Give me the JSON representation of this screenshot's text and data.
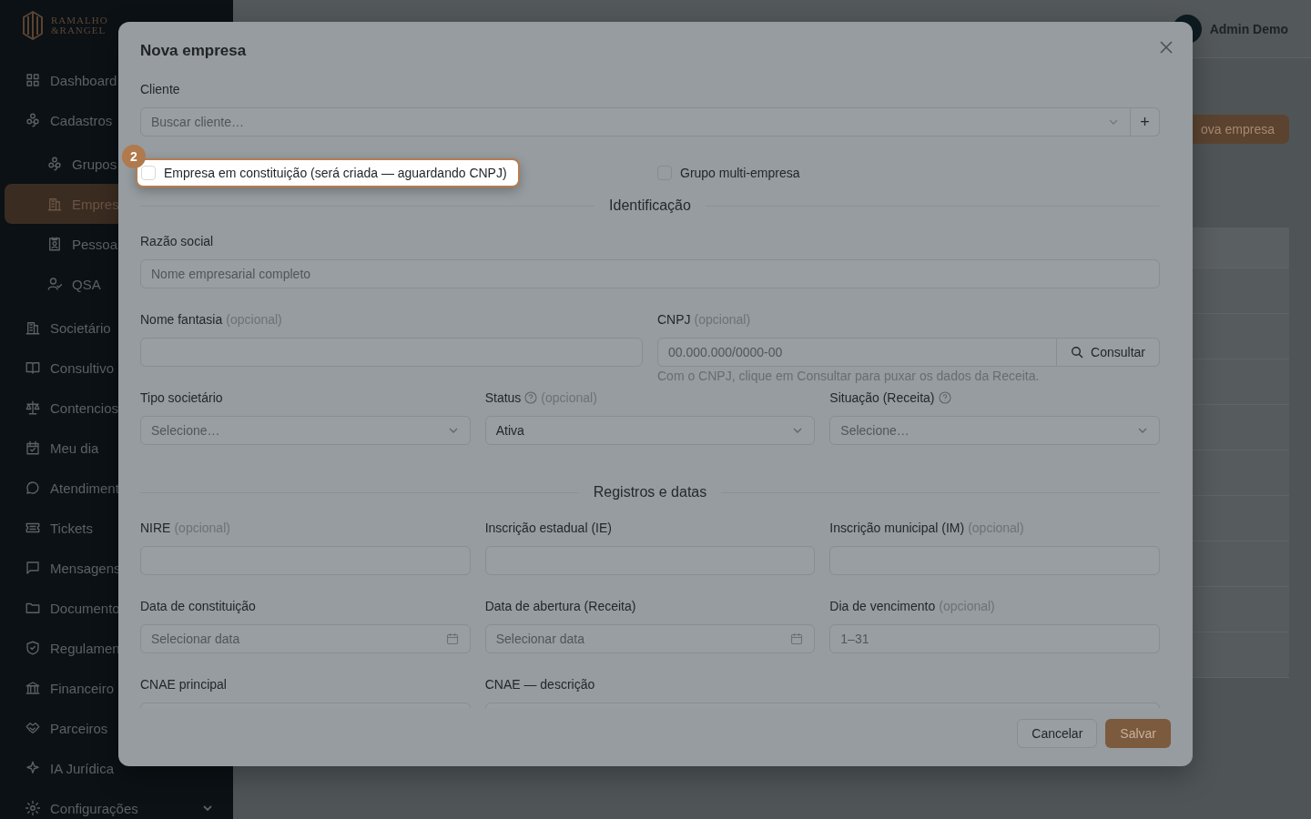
{
  "brand": {
    "line1": "RAMALHO",
    "line2": "&RANGEL"
  },
  "sidebar": {
    "items": [
      {
        "label": "Dashboard",
        "selected": false
      },
      {
        "label": "Cadastros",
        "selected": false,
        "expanded": true,
        "children": [
          {
            "label": "Grupos",
            "selected": false
          },
          {
            "label": "Empres",
            "selected": true
          },
          {
            "label": "Pessoa",
            "selected": false
          },
          {
            "label": "QSA",
            "selected": false
          }
        ]
      },
      {
        "label": "Societário",
        "selected": false
      },
      {
        "label": "Consultivo",
        "selected": false
      },
      {
        "label": "Contencios",
        "selected": false
      },
      {
        "label": "Meu dia",
        "selected": false
      },
      {
        "label": "Atendiment",
        "selected": false
      },
      {
        "label": "Tickets",
        "selected": false
      },
      {
        "label": "Mensagens",
        "selected": false
      },
      {
        "label": "Documento",
        "selected": false
      },
      {
        "label": "Regulamen",
        "selected": false
      },
      {
        "label": "Financeiro",
        "selected": false
      },
      {
        "label": "Parceiros",
        "selected": false
      },
      {
        "label": "IA Jurídica",
        "selected": false
      },
      {
        "label": "Configurações",
        "selected": false,
        "expanded": false
      }
    ]
  },
  "header": {
    "user": "Admin Demo"
  },
  "page": {
    "new_button": "ova empresa"
  },
  "modal": {
    "title": "Nova empresa",
    "client": {
      "label": "Cliente",
      "placeholder": "Buscar cliente…",
      "add": "+"
    },
    "tour_step": "2",
    "checkboxes": [
      {
        "label": "Empresa em constituição (será criada — aguardando CNPJ)",
        "checked": false,
        "highlighted": true
      },
      {
        "label": "Grupo multi-empresa",
        "checked": false,
        "highlighted": false
      }
    ],
    "sections": [
      {
        "title": "Identificação",
        "rows": [
          {
            "fields": [
              {
                "label": "Razão social",
                "kind": "text",
                "placeholder": "Nome empresarial completo"
              }
            ]
          },
          {
            "fields": [
              {
                "label": "Nome fantasia",
                "optional": "(opcional)",
                "kind": "text"
              },
              {
                "label": "CNPJ",
                "optional": "(opcional)",
                "kind": "cnpj",
                "placeholder": "00.000.000/0000-00",
                "button": "Consultar",
                "hint": "Com o CNPJ, clique em Consultar para puxar os dados da Receita."
              }
            ]
          },
          {
            "fields": [
              {
                "label": "Tipo societário",
                "kind": "select",
                "placeholder": "Selecione…"
              },
              {
                "label": "Status",
                "optional": "(opcional)",
                "help": true,
                "kind": "select",
                "value": "Ativa"
              },
              {
                "label": "Situação (Receita)",
                "help": true,
                "kind": "select",
                "placeholder": "Selecione…"
              }
            ]
          }
        ]
      },
      {
        "title": "Registros e datas",
        "rows": [
          {
            "fields": [
              {
                "label": "NIRE",
                "optional": "(opcional)",
                "kind": "text"
              },
              {
                "label": "Inscrição estadual (IE)",
                "kind": "text"
              },
              {
                "label": "Inscrição municipal (IM)",
                "optional": "(opcional)",
                "kind": "text"
              }
            ]
          },
          {
            "fields": [
              {
                "label": "Data de constituição",
                "kind": "date",
                "placeholder": "Selecionar data"
              },
              {
                "label": "Data de abertura (Receita)",
                "kind": "date",
                "placeholder": "Selecionar data"
              },
              {
                "label": "Dia de vencimento",
                "optional": "(opcional)",
                "kind": "text",
                "placeholder": "1–31"
              }
            ]
          },
          {
            "fields": [
              {
                "label": "CNAE principal",
                "kind": "text"
              },
              {
                "label": "CNAE — descrição",
                "kind": "text",
                "wide": true
              }
            ]
          }
        ]
      }
    ],
    "buttons": {
      "cancel": "Cancelar",
      "save": "Salvar"
    }
  }
}
